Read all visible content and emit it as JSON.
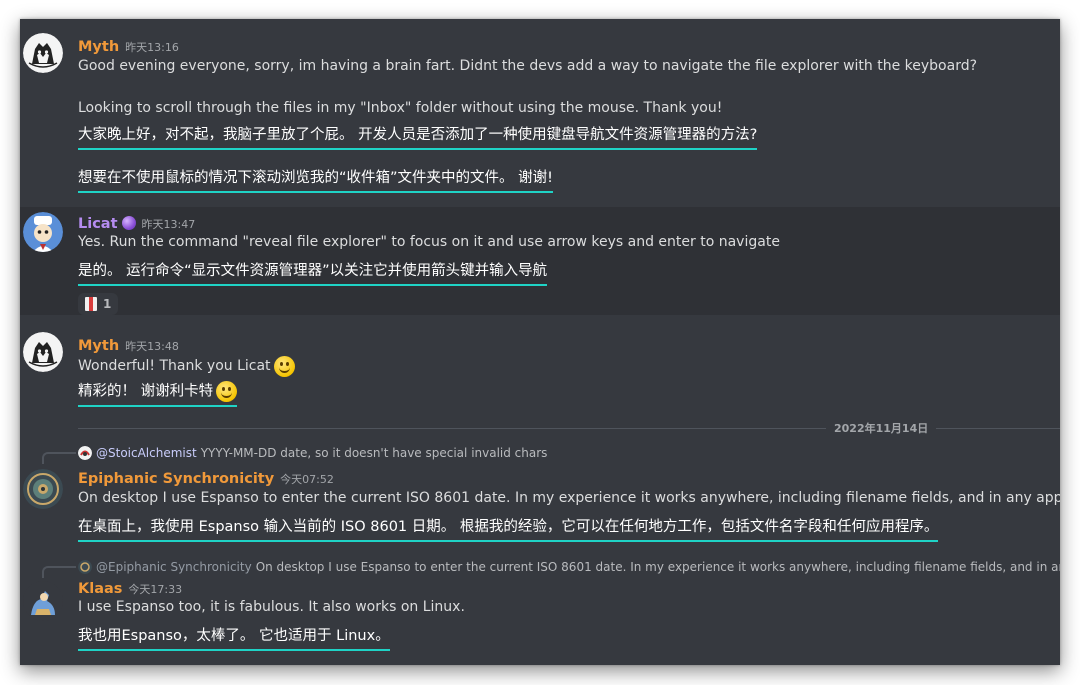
{
  "messages": {
    "m1": {
      "author": "Myth",
      "timestamp": "昨天13:16",
      "line1": "Good evening everyone, sorry, im having a brain fart. Didnt the devs add a way to navigate the file explorer with the keyboard?",
      "line2": "Looking to scroll through the files in my \"Inbox\" folder  without using the mouse. Thank you!",
      "trans1": "大家晚上好，对不起，我脑子里放了个屁。 开发人员是否添加了一种使用键盘导航文件资源管理器的方法?",
      "trans2": " 想要在不使用鼠标的情况下滚动浏览我的“收件箱”文件夹中的文件。 谢谢!"
    },
    "m2": {
      "author": "Licat",
      "timestamp": "昨天13:47",
      "line1": "Yes. Run the command \"reveal file explorer\" to focus on it and use arrow keys and enter to navigate",
      "trans1": "是的。 运行命令“显示文件资源管理器”以关注它并使用箭头键并输入导航",
      "reaction_count": "1"
    },
    "m3": {
      "author": "Myth",
      "timestamp": "昨天13:48",
      "line1": "Wonderful! Thank you Licat",
      "trans1": "精彩的！ 谢谢利卡特"
    },
    "date_divider": "2022年11月14日",
    "m4": {
      "reply_mention": "@StoicAlchemist",
      "reply_text": "YYYY-MM-DD date, so it doesn't have special invalid chars",
      "author": "Epiphanic Synchronicity",
      "timestamp": "今天07:52",
      "line1": "On desktop I use Espanso to enter the current ISO 8601 date. In my experience it works anywhere, including filename fields, and in any app.",
      "trans1": "在桌面上，我使用 Espanso 输入当前的 ISO 8601 日期。 根据我的经验，它可以在任何地方工作，包括文件名字段和任何应用程序。"
    },
    "m5": {
      "reply_mention": "@Epiphanic Synchronicity",
      "reply_text": "On desktop I use Espanso to enter the current ISO 8601 date. In my experience it works anywhere, including filename fields, and in any app.",
      "author": "Klaas",
      "timestamp": "今天17:33",
      "line1": "I use Espanso too, it is fabulous. It also works on Linux.",
      "trans1": "我也用Espanso，太棒了。 它也适用于 Linux。"
    }
  },
  "colors": {
    "background": "#36393f",
    "hover_background": "#2f3136",
    "username_orange": "#f0993a",
    "username_purple": "#b58cf0",
    "translation_underline": "#1fd3c6",
    "text": "#dcddde"
  },
  "icons": [
    "myth-avatar",
    "licat-avatar",
    "epiphanic-avatar",
    "klaas-avatar",
    "crystal-orb-badge",
    "book-reaction-icon",
    "smile-emoji"
  ]
}
